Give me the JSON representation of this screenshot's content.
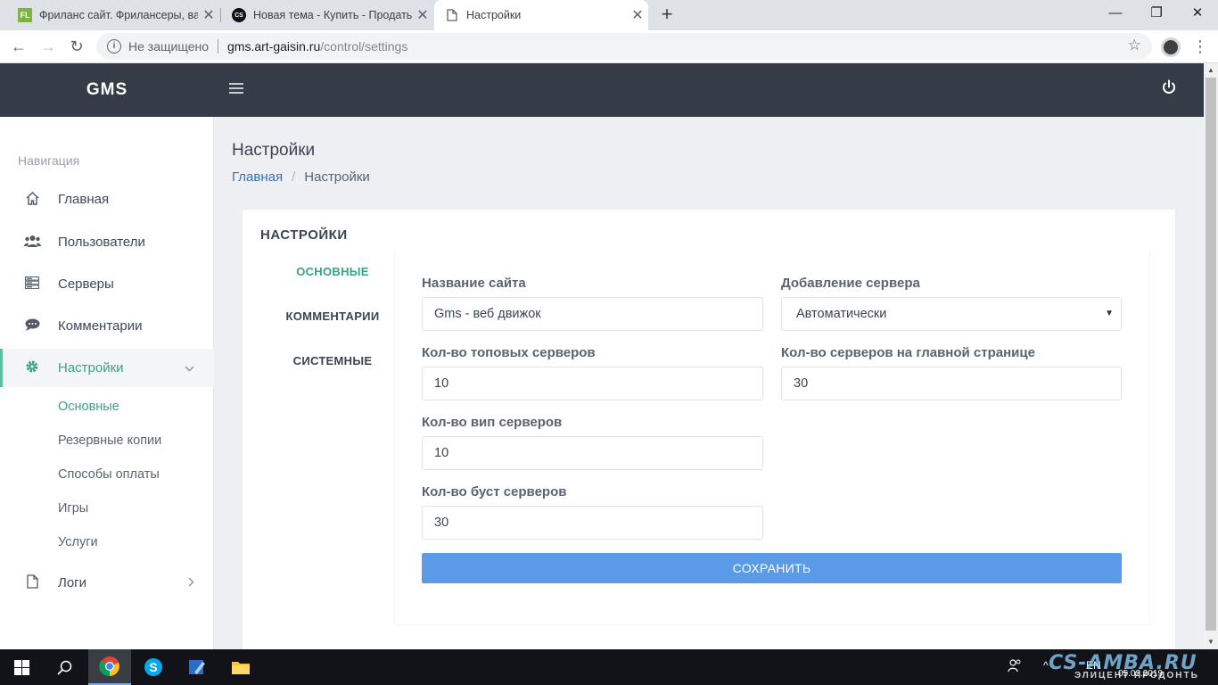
{
  "browser": {
    "tabs": [
      {
        "title": "Фриланс сайт. Фрилансеры, вак",
        "favicon": "FL"
      },
      {
        "title": "Новая тема - Купить - Продать",
        "favicon": "CS"
      },
      {
        "title": "Настройки",
        "favicon": "page-icon"
      }
    ],
    "security_label": "Не защищено",
    "url_host": "gms.art-gaisin.ru",
    "url_path": "/control/settings"
  },
  "app": {
    "brand": "GMS"
  },
  "sidebar": {
    "heading": "Навигация",
    "items": [
      {
        "label": "Главная",
        "icon": "home-icon"
      },
      {
        "label": "Пользователи",
        "icon": "users-icon"
      },
      {
        "label": "Серверы",
        "icon": "servers-icon"
      },
      {
        "label": "Комментарии",
        "icon": "comment-icon"
      },
      {
        "label": "Настройки",
        "icon": "gear-icon"
      },
      {
        "label": "Логи",
        "icon": "file-icon"
      }
    ],
    "subitems": [
      "Основные",
      "Резервные копии",
      "Способы оплаты",
      "Игры",
      "Услуги"
    ]
  },
  "page": {
    "title": "Настройки",
    "breadcrumb": {
      "home": "Главная",
      "current": "Настройки"
    }
  },
  "card": {
    "title": "НАСТРОЙКИ",
    "tabs": [
      "ОСНОВНЫЕ",
      "КОММЕНТАРИИ",
      "СИСТЕМНЫЕ"
    ],
    "fields": {
      "site_name": {
        "label": "Название сайта",
        "value": "Gms - веб движок"
      },
      "server_add": {
        "label": "Добавление сервера",
        "value": "Автоматически"
      },
      "top_servers": {
        "label": "Кол-во топовых серверов",
        "value": "10"
      },
      "main_servers": {
        "label": "Кол-во серверов на главной странице",
        "value": "30"
      },
      "vip_servers": {
        "label": "Кол-во вип серверов",
        "value": "10"
      },
      "boost_servers": {
        "label": "Кол-во буст серверов",
        "value": "30"
      }
    },
    "save_label": "СОХРАНИТЬ"
  },
  "taskbar": {
    "lang": "EN",
    "date": "05.02.2019",
    "watermark": "CS-AMBA.RU",
    "watermark_sub": "ЭЛИЦЕНТ ПРОДОНТЬ"
  },
  "colors": {
    "header_bg": "#353c48",
    "accent_green": "#3aa284",
    "save_button": "#5a9ae6",
    "link_blue": "#3a6fb2"
  }
}
